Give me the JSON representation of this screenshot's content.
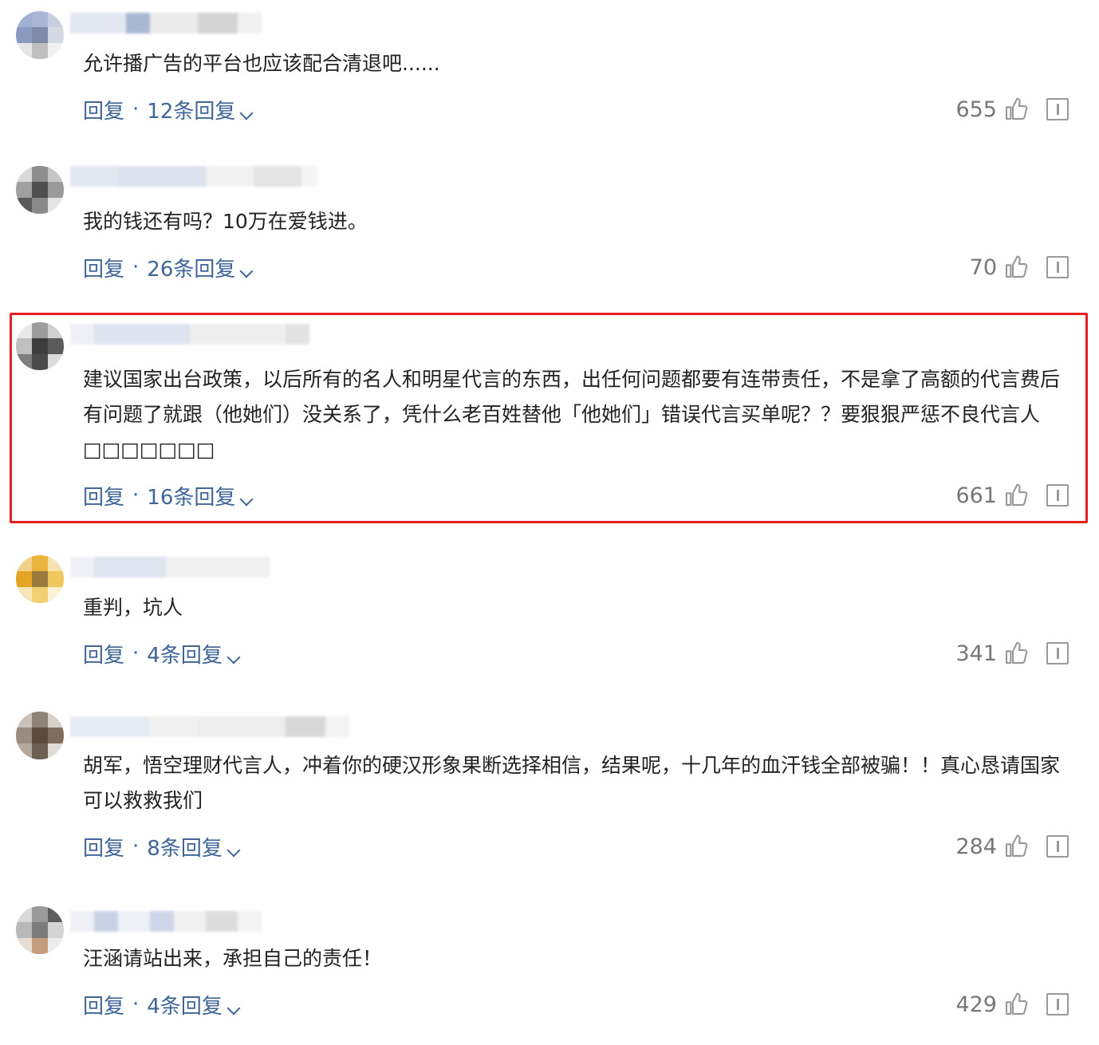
{
  "ui": {
    "reply_label": "回复",
    "separator": "·",
    "accent_color": "#406599",
    "highlight_color": "#e61e1e"
  },
  "comments": [
    {
      "text": "允许播广告的平台也应该配合清退吧......",
      "replies": "12条回复",
      "likes": "655"
    },
    {
      "text": "我的钱还有吗？10万在爱钱进。",
      "replies": "26条回复",
      "likes": "70"
    },
    {
      "text": "建议国家出台政策，以后所有的名人和明星代言的东西，出任何问题都要有连带责任，不是拿了高额的代言费后有问题了就跟（他她们）没关系了，凭什么老百姓替他「他她们」错误代言买单呢？？要狠狠严惩不良代言人□□□□□□□",
      "replies": "16条回复",
      "likes": "661",
      "highlighted": true
    },
    {
      "text": "重判，坑人",
      "replies": "4条回复",
      "likes": "341"
    },
    {
      "text": "胡军，悟空理财代言人，冲着你的硬汉形象果断选择相信，结果呢，十几年的血汗钱全部被骗！！真心恳请国家可以救救我们",
      "replies": "8条回复",
      "likes": "284"
    },
    {
      "text": "汪涵请站出来，承担自己的责任！",
      "replies": "4条回复",
      "likes": "429"
    }
  ]
}
